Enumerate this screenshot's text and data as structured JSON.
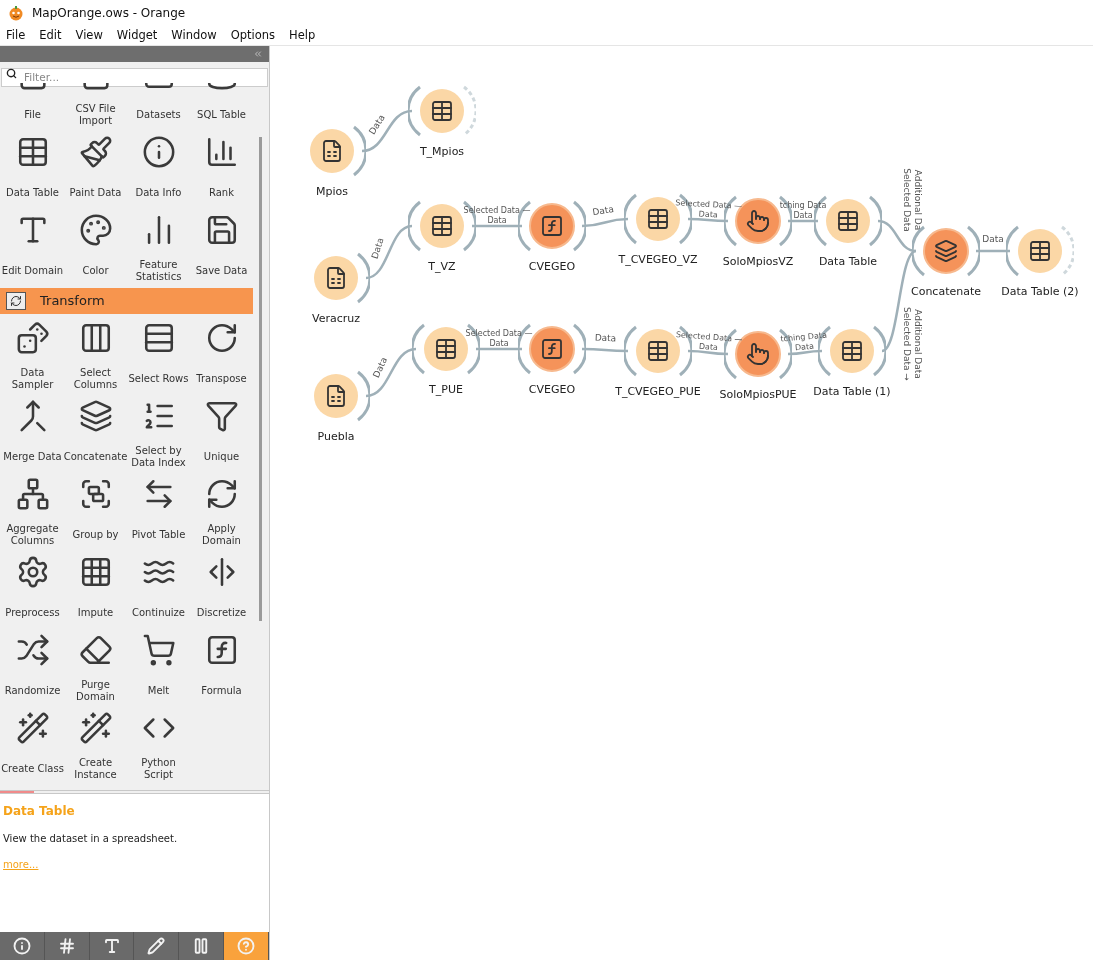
{
  "window": {
    "title": "MapOrange.ows - Orange"
  },
  "menu": [
    "File",
    "Edit",
    "View",
    "Widget",
    "Window",
    "Options",
    "Help"
  ],
  "toolbox": {
    "filter": {
      "placeholder": "Filter..."
    },
    "widgets_top": [
      {
        "label": "File",
        "kind": "file"
      },
      {
        "label": "CSV File Import",
        "kind": "csv"
      },
      {
        "label": "Datasets",
        "kind": "datasets"
      },
      {
        "label": "SQL Table",
        "kind": "sql"
      },
      {
        "label": "Data Table",
        "kind": "table"
      },
      {
        "label": "Paint Data",
        "kind": "paint"
      },
      {
        "label": "Data Info",
        "kind": "info"
      },
      {
        "label": "Rank",
        "kind": "rank"
      },
      {
        "label": "Edit Domain",
        "kind": "edit"
      },
      {
        "label": "Color",
        "kind": "color"
      },
      {
        "label": "Feature Statistics",
        "kind": "stats"
      },
      {
        "label": "Save Data",
        "kind": "save"
      }
    ],
    "category": {
      "label": "Transform",
      "expanded": true
    },
    "widgets_category": [
      {
        "label": "Data Sampler",
        "kind": "dice"
      },
      {
        "label": "Select Columns",
        "kind": "selectcols"
      },
      {
        "label": "Select Rows",
        "kind": "selectrows"
      },
      {
        "label": "Transpose",
        "kind": "transpose"
      },
      {
        "label": "Merge Data",
        "kind": "merge"
      },
      {
        "label": "Concatenate",
        "kind": "concat"
      },
      {
        "label": "Select by Data Index",
        "kind": "index"
      },
      {
        "label": "Unique",
        "kind": "unique"
      },
      {
        "label": "Aggregate Columns",
        "kind": "aggregate"
      },
      {
        "label": "Group by",
        "kind": "groupby"
      },
      {
        "label": "Pivot Table",
        "kind": "pivot"
      },
      {
        "label": "Apply Domain",
        "kind": "apply"
      },
      {
        "label": "Preprocess",
        "kind": "preprocess"
      },
      {
        "label": "Impute",
        "kind": "impute"
      },
      {
        "label": "Continuize",
        "kind": "continuize"
      },
      {
        "label": "Discretize",
        "kind": "discretize"
      },
      {
        "label": "Randomize",
        "kind": "randomize"
      },
      {
        "label": "Purge Domain",
        "kind": "purge"
      },
      {
        "label": "Melt",
        "kind": "melt"
      },
      {
        "label": "Formula",
        "kind": "formula"
      },
      {
        "label": "Create Class",
        "kind": "wand"
      },
      {
        "label": "Create Instance",
        "kind": "wand"
      },
      {
        "label": "Python Script",
        "kind": "python"
      }
    ]
  },
  "description": {
    "title": "Data Table",
    "text": "View the dataset in a spreadsheet.",
    "link": "more..."
  },
  "bottom_toolbar": [
    {
      "kind": "info",
      "selected": false
    },
    {
      "kind": "grid",
      "selected": false
    },
    {
      "kind": "text",
      "selected": false
    },
    {
      "kind": "pen",
      "selected": false
    },
    {
      "kind": "pause",
      "selected": false
    },
    {
      "kind": "help",
      "selected": true
    }
  ],
  "canvas": {
    "nodes": [
      {
        "label": "Mpios",
        "kind": "file",
        "has_input": false,
        "output_linked": true
      },
      {
        "label": "T_Mpios",
        "kind": "table",
        "has_input": true,
        "output_linked": false
      },
      {
        "label": "Veracruz",
        "kind": "file",
        "has_input": false,
        "output_linked": true
      },
      {
        "label": "T_VZ",
        "kind": "table",
        "has_input": true,
        "output_linked": true
      },
      {
        "label": "CVEGEO",
        "kind": "formula",
        "has_input": true,
        "output_linked": true
      },
      {
        "label": "T_CVEGEO_VZ",
        "kind": "table",
        "has_input": true,
        "output_linked": true
      },
      {
        "label": "SoloMpiosVZ",
        "kind": "select",
        "has_input": true,
        "output_linked": true
      },
      {
        "label": "Data Table",
        "kind": "table",
        "has_input": true,
        "output_linked": true
      },
      {
        "label": "Concatenate",
        "kind": "concat",
        "has_input": true,
        "output_linked": true
      },
      {
        "label": "Data Table (2)",
        "kind": "table",
        "has_input": true,
        "output_linked": false
      },
      {
        "label": "Puebla",
        "kind": "file",
        "has_input": false,
        "output_linked": true
      },
      {
        "label": "T_PUE",
        "kind": "table",
        "has_input": true,
        "output_linked": true
      },
      {
        "label": "CVEGEO",
        "kind": "formula",
        "has_input": true,
        "output_linked": true
      },
      {
        "label": "T_CVEGEO_PUE",
        "kind": "table",
        "has_input": true,
        "output_linked": true
      },
      {
        "label": "SoloMpiosPUE",
        "kind": "select",
        "has_input": true,
        "output_linked": true
      },
      {
        "label": "Data Table (1)",
        "kind": "table",
        "has_input": true,
        "output_linked": true
      }
    ],
    "links": [
      {
        "labels": [
          "Data"
        ]
      },
      {
        "labels": [
          "Data"
        ]
      },
      {
        "labels": [
          "Selected Data —",
          "Data"
        ]
      },
      {
        "labels": [
          "Data"
        ]
      },
      {
        "labels": [
          "Selected Data —",
          "Data"
        ]
      },
      {
        "labels": [
          "tching Data",
          "Data"
        ]
      },
      {
        "labels": [
          "Selected Data",
          "Additional Da"
        ]
      },
      {
        "labels": [
          "Data"
        ]
      },
      {
        "labels": [
          "Data"
        ]
      },
      {
        "labels": [
          "Selected Data —",
          "Data"
        ]
      },
      {
        "labels": [
          "Data"
        ]
      },
      {
        "labels": [
          "Selected Data —",
          "Data"
        ]
      },
      {
        "labels": [
          "tching Data",
          "Data"
        ]
      },
      {
        "labels": [
          "Selected Data →",
          "Additional Data"
        ]
      }
    ]
  }
}
